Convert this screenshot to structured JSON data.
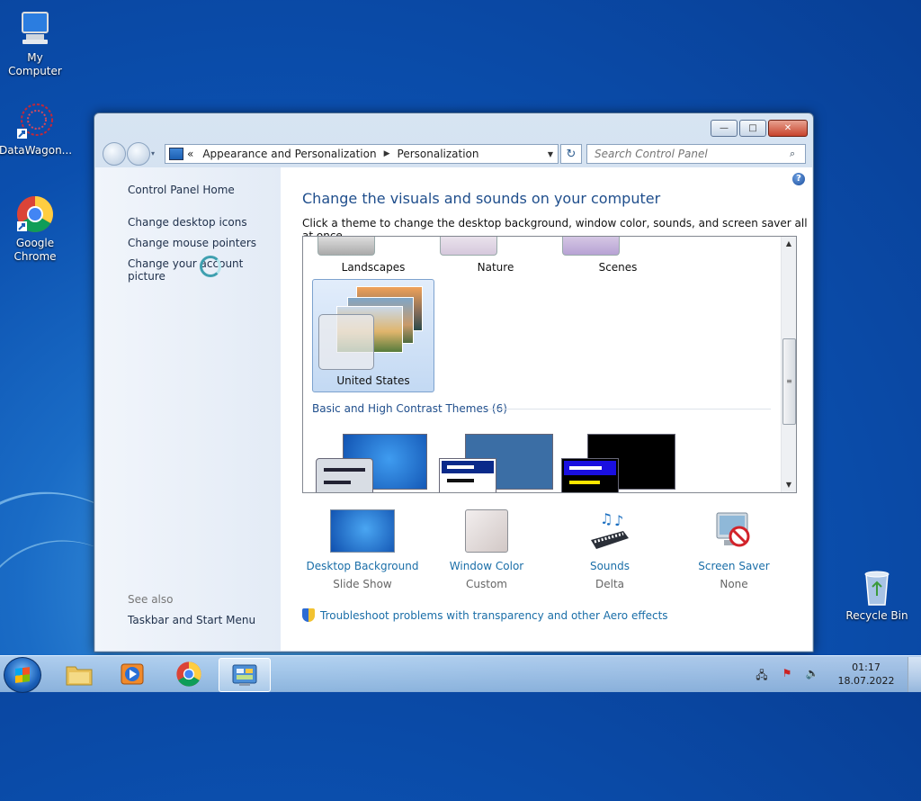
{
  "desktop": {
    "icons": [
      {
        "label": "My Computer",
        "icon": "computer-icon"
      },
      {
        "label": "DataWagon...",
        "icon": "datawagon-icon"
      },
      {
        "label": "Google Chrome",
        "icon": "chrome-icon"
      },
      {
        "label": "Recycle Bin",
        "icon": "recycle-bin-icon"
      }
    ]
  },
  "window": {
    "caption_buttons": {
      "minimize": "—",
      "maximize": "□",
      "close": "✕"
    },
    "address": {
      "overflow": "«",
      "crumbs": [
        "Appearance and Personalization",
        "Personalization"
      ]
    },
    "search_placeholder": "Search Control Panel",
    "help_label": "?"
  },
  "left_pane": {
    "home": "Control Panel Home",
    "links": [
      "Change desktop icons",
      "Change mouse pointers",
      "Change your account picture"
    ],
    "see_also": "See also",
    "see_also_links": [
      "Taskbar and Start Menu"
    ]
  },
  "main": {
    "title": "Change the visuals and sounds on your computer",
    "subtitle": "Click a theme to change the desktop background, window color, sounds, and screen saver all at once.",
    "themes_top_row": [
      "Landscapes",
      "Nature",
      "Scenes"
    ],
    "selected_theme": "United States",
    "basic_section": "Basic and High Contrast Themes (6)",
    "pickers": [
      {
        "label": "Desktop Background",
        "value": "Slide Show",
        "icon": "desktop-background-icon"
      },
      {
        "label": "Window Color",
        "value": "Custom",
        "icon": "window-color-icon"
      },
      {
        "label": "Sounds",
        "value": "Delta",
        "icon": "sounds-icon"
      },
      {
        "label": "Screen Saver",
        "value": "None",
        "icon": "screen-saver-icon"
      }
    ],
    "troubleshoot": "Troubleshoot problems with transparency and other Aero effects"
  },
  "taskbar": {
    "pinned": [
      "explorer-icon",
      "media-player-icon",
      "chrome-icon",
      "control-panel-icon"
    ],
    "clock_time": "01:17",
    "clock_date": "18.07.2022"
  }
}
